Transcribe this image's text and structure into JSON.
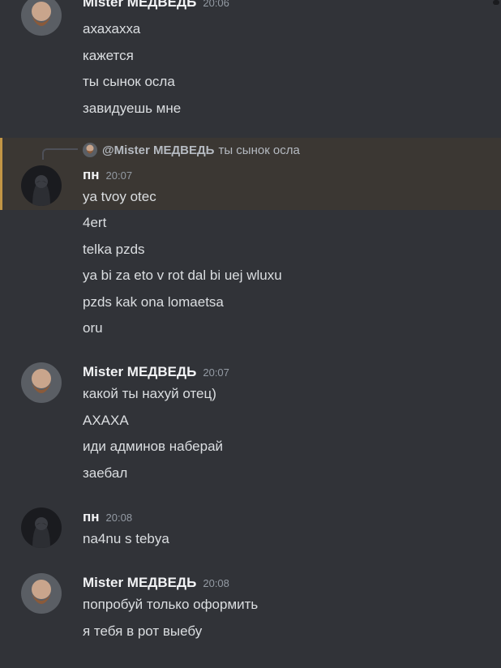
{
  "groups": [
    {
      "author": "Mister МЕДВЕДЬ",
      "time": "20:06",
      "messages": [
        "ахахахха",
        "кажется",
        "ты сынок осла",
        "завидуешь мне"
      ]
    },
    {
      "reply": {
        "author": "@Mister МЕДВЕДЬ",
        "text": "ты сынок осла"
      },
      "author": "пн",
      "time": "20:07",
      "messages": [
        "ya tvoy otec",
        "4ert",
        "telka pzds",
        "ya bi za eto v rot dal bi uej wluxu",
        "pzds kak ona lomaetsa",
        "oru"
      ]
    },
    {
      "author": "Mister МЕДВЕДЬ",
      "time": "20:07",
      "messages": [
        "какой ты нахуй отец)",
        "АХАХА",
        "иди админов наберай",
        "заебал"
      ]
    },
    {
      "author": "пн",
      "time": "20:08",
      "messages": [
        "na4nu s tebya"
      ]
    },
    {
      "author": "Mister МЕДВЕДЬ",
      "time": "20:08",
      "messages": [
        "попробуй только оформить",
        "я тебя в рот выебу"
      ]
    }
  ],
  "colors": {
    "background": "#313338",
    "mention_highlight": "#3b3733",
    "mention_border": "#c29545",
    "author": "#f2f3f5",
    "timestamp": "#949ba4"
  }
}
